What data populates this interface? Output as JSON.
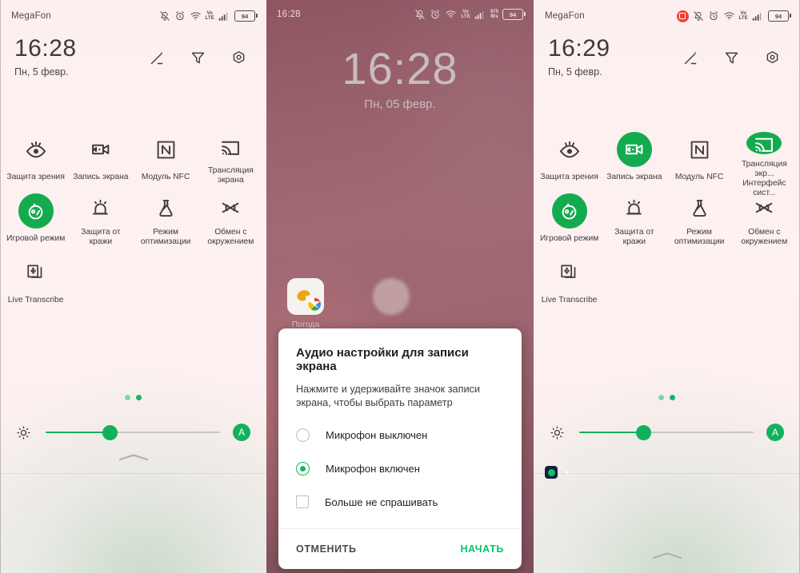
{
  "panel1": {
    "status_bar": {
      "carrier": "MegaFon",
      "battery_percent": "94",
      "network_type_top": "Vo",
      "network_type_bottom": "LTE",
      "icons": [
        "bell-off-icon",
        "alarm-icon",
        "wifi-icon",
        "volte-icon",
        "signal-icon",
        "battery-icon"
      ]
    },
    "clock": {
      "time": "16:28",
      "date": "Пн, 5 февр."
    },
    "header_actions": [
      "brightness-edit-icon",
      "filter-icon",
      "settings-gear-icon"
    ],
    "tiles": [
      {
        "label": "Защита зрения",
        "sub": "",
        "icon": "eye-care-icon",
        "active": false
      },
      {
        "label": "Запись экрана",
        "sub": "",
        "icon": "screen-record-icon",
        "active": false
      },
      {
        "label": "Модуль NFC",
        "sub": "",
        "icon": "nfc-icon",
        "active": false
      },
      {
        "label": "Трансляция",
        "sub": "экрана",
        "icon": "cast-icon",
        "active": false
      },
      {
        "label": "Игровой режим",
        "sub": "",
        "icon": "game-mode-icon",
        "active": true
      },
      {
        "label": "Защита от кражи",
        "sub": "",
        "icon": "anti-theft-icon",
        "active": false
      },
      {
        "label": "Режим",
        "sub": "оптимизации",
        "icon": "flask-icon",
        "active": false
      },
      {
        "label": "Обмен с",
        "sub": "окружением",
        "icon": "nearby-share-icon",
        "active": false
      },
      {
        "label": "Live Transcribe",
        "sub": "",
        "icon": "live-transcribe-icon",
        "active": false
      }
    ],
    "pager": {
      "pages": 2,
      "current": 2
    },
    "brightness": {
      "icon": "brightness-icon",
      "value_percent": 37,
      "auto_label": "A"
    }
  },
  "panel2": {
    "status_bar": {
      "time": "16:28",
      "battery_percent": "94",
      "network_type_top": "Vo",
      "network_type_bottom": "LTE",
      "net_speed_top": "975",
      "net_speed_bottom": "B/s"
    },
    "lockscreen": {
      "time": "16:28",
      "date": "Пн, 05 февр."
    },
    "apps": [
      {
        "label": "Погода",
        "icon": "weather-app-icon"
      },
      {
        "label": "",
        "icon": "blurred-app-icon"
      }
    ],
    "dialog": {
      "title": "Аудио настройки для записи экрана",
      "message": "Нажмите и удерживайте значок записи экрана, чтобы выбрать параметр",
      "options": [
        {
          "label": "Микрофон выключен",
          "type": "radio",
          "selected": false
        },
        {
          "label": "Микрофон включен",
          "type": "radio",
          "selected": true
        },
        {
          "label": "Больше не спрашивать",
          "type": "checkbox",
          "selected": false
        }
      ],
      "cancel_label": "ОТМЕНИТЬ",
      "confirm_label": "НАЧАТЬ",
      "accent_color": "#04c765"
    }
  },
  "panel3": {
    "status_bar": {
      "carrier": "MegaFon",
      "battery_percent": "94",
      "network_type_top": "Vo",
      "network_type_bottom": "LTE",
      "recording_indicator": true
    },
    "clock": {
      "time": "16:29",
      "date": "Пн, 5 февр."
    },
    "header_actions": [
      "brightness-edit-icon",
      "filter-icon",
      "settings-gear-icon"
    ],
    "tiles": [
      {
        "label": "Защита зрения",
        "sub": "",
        "icon": "eye-care-icon",
        "active": false
      },
      {
        "label": "Запись экрана",
        "sub": "",
        "icon": "screen-record-icon",
        "active": true
      },
      {
        "label": "Модуль NFC",
        "sub": "",
        "icon": "nfc-icon",
        "active": false
      },
      {
        "label": "Трансляция экр...",
        "sub": "Интерфейс сист...",
        "icon": "cast-icon",
        "active": true
      },
      {
        "label": "Игровой режим",
        "sub": "",
        "icon": "game-mode-icon",
        "active": true
      },
      {
        "label": "Защита от кражи",
        "sub": "",
        "icon": "anti-theft-icon",
        "active": false
      },
      {
        "label": "Режим",
        "sub": "оптимизации",
        "icon": "flask-icon",
        "active": false
      },
      {
        "label": "Обмен с",
        "sub": "окружением",
        "icon": "nearby-share-icon",
        "active": false
      },
      {
        "label": "Live Transcribe",
        "sub": "",
        "icon": "live-transcribe-icon",
        "active": false
      }
    ],
    "pager": {
      "pages": 2,
      "current": 2
    },
    "brightness": {
      "icon": "brightness-icon",
      "value_percent": 37,
      "auto_label": "A"
    },
    "notifications": [
      {
        "icon": "screen-record-notification-icon"
      }
    ]
  },
  "theme": {
    "accent_green": "#14ab4f",
    "record_red": "#f04134",
    "shade_pink": "#fdf0f0"
  }
}
